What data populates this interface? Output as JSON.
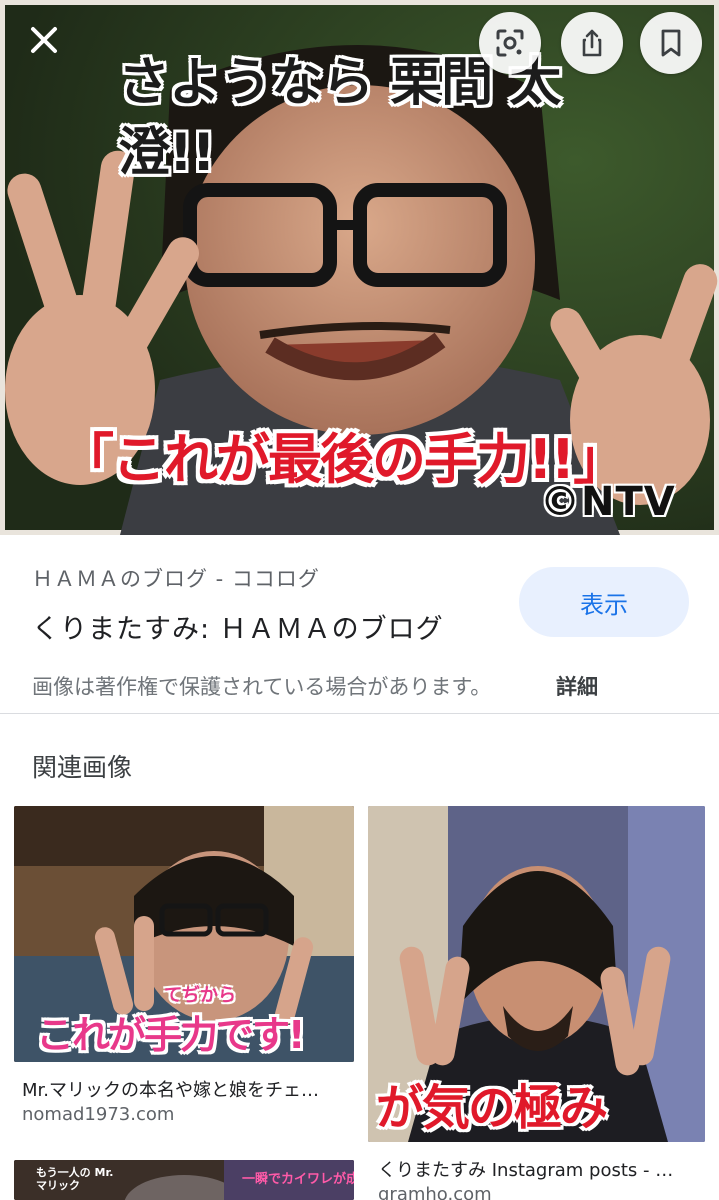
{
  "viewer": {
    "close_icon": "close-icon",
    "lens_icon": "lens-icon",
    "share_icon": "share-icon",
    "bookmark_icon": "bookmark-icon"
  },
  "main_image": {
    "caption_top": "さようなら 栗間 太澄!!",
    "caption_bottom": "「これが最後の手力!!」",
    "watermark": "©NTV"
  },
  "source": {
    "site": "ＨＡＭＡのブログ - ココログ",
    "title": "くりまたすみ: ＨＡＭＡのブログ",
    "view_label": "表示",
    "copyright_notice": "画像は著作権で保護されている場合があります。",
    "details_label": "詳細"
  },
  "related": {
    "heading": "関連画像",
    "items": [
      {
        "title": "Mr.マリックの本名や嫁と娘をチェ…",
        "site": "nomad1973.com",
        "caption_small": "てぢから",
        "caption_main": "これが手力です!"
      },
      {
        "title": "くりまたすみ Instagram posts - …",
        "site": "gramho.com",
        "caption_main": "が気の極み"
      },
      {
        "caption_small": "もう一人の Mr.マリック",
        "caption_extra": "一瞬でカイワレが成長"
      }
    ]
  },
  "colors": {
    "accent": "#1a73e8",
    "view_button_bg": "#e8f0fe",
    "caption_red": "#e0192a"
  }
}
